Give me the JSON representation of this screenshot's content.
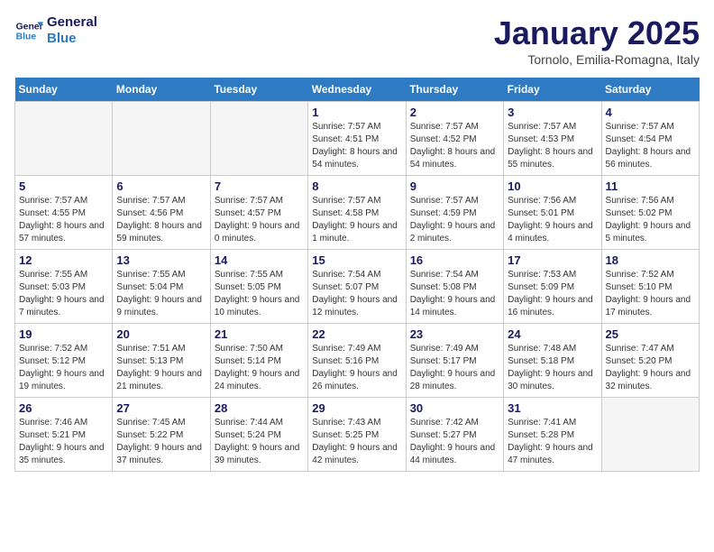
{
  "logo": {
    "line1": "General",
    "line2": "Blue"
  },
  "title": "January 2025",
  "subtitle": "Tornolo, Emilia-Romagna, Italy",
  "days_of_week": [
    "Sunday",
    "Monday",
    "Tuesday",
    "Wednesday",
    "Thursday",
    "Friday",
    "Saturday"
  ],
  "weeks": [
    [
      {
        "day": "",
        "empty": true
      },
      {
        "day": "",
        "empty": true
      },
      {
        "day": "",
        "empty": true
      },
      {
        "day": "1",
        "sunrise": "7:57 AM",
        "sunset": "4:51 PM",
        "daylight": "8 hours and 54 minutes."
      },
      {
        "day": "2",
        "sunrise": "7:57 AM",
        "sunset": "4:52 PM",
        "daylight": "8 hours and 54 minutes."
      },
      {
        "day": "3",
        "sunrise": "7:57 AM",
        "sunset": "4:53 PM",
        "daylight": "8 hours and 55 minutes."
      },
      {
        "day": "4",
        "sunrise": "7:57 AM",
        "sunset": "4:54 PM",
        "daylight": "8 hours and 56 minutes."
      }
    ],
    [
      {
        "day": "5",
        "sunrise": "7:57 AM",
        "sunset": "4:55 PM",
        "daylight": "8 hours and 57 minutes."
      },
      {
        "day": "6",
        "sunrise": "7:57 AM",
        "sunset": "4:56 PM",
        "daylight": "8 hours and 59 minutes."
      },
      {
        "day": "7",
        "sunrise": "7:57 AM",
        "sunset": "4:57 PM",
        "daylight": "9 hours and 0 minutes."
      },
      {
        "day": "8",
        "sunrise": "7:57 AM",
        "sunset": "4:58 PM",
        "daylight": "9 hours and 1 minute."
      },
      {
        "day": "9",
        "sunrise": "7:57 AM",
        "sunset": "4:59 PM",
        "daylight": "9 hours and 2 minutes."
      },
      {
        "day": "10",
        "sunrise": "7:56 AM",
        "sunset": "5:01 PM",
        "daylight": "9 hours and 4 minutes."
      },
      {
        "day": "11",
        "sunrise": "7:56 AM",
        "sunset": "5:02 PM",
        "daylight": "9 hours and 5 minutes."
      }
    ],
    [
      {
        "day": "12",
        "sunrise": "7:55 AM",
        "sunset": "5:03 PM",
        "daylight": "9 hours and 7 minutes."
      },
      {
        "day": "13",
        "sunrise": "7:55 AM",
        "sunset": "5:04 PM",
        "daylight": "9 hours and 9 minutes."
      },
      {
        "day": "14",
        "sunrise": "7:55 AM",
        "sunset": "5:05 PM",
        "daylight": "9 hours and 10 minutes."
      },
      {
        "day": "15",
        "sunrise": "7:54 AM",
        "sunset": "5:07 PM",
        "daylight": "9 hours and 12 minutes."
      },
      {
        "day": "16",
        "sunrise": "7:54 AM",
        "sunset": "5:08 PM",
        "daylight": "9 hours and 14 minutes."
      },
      {
        "day": "17",
        "sunrise": "7:53 AM",
        "sunset": "5:09 PM",
        "daylight": "9 hours and 16 minutes."
      },
      {
        "day": "18",
        "sunrise": "7:52 AM",
        "sunset": "5:10 PM",
        "daylight": "9 hours and 17 minutes."
      }
    ],
    [
      {
        "day": "19",
        "sunrise": "7:52 AM",
        "sunset": "5:12 PM",
        "daylight": "9 hours and 19 minutes."
      },
      {
        "day": "20",
        "sunrise": "7:51 AM",
        "sunset": "5:13 PM",
        "daylight": "9 hours and 21 minutes."
      },
      {
        "day": "21",
        "sunrise": "7:50 AM",
        "sunset": "5:14 PM",
        "daylight": "9 hours and 24 minutes."
      },
      {
        "day": "22",
        "sunrise": "7:49 AM",
        "sunset": "5:16 PM",
        "daylight": "9 hours and 26 minutes."
      },
      {
        "day": "23",
        "sunrise": "7:49 AM",
        "sunset": "5:17 PM",
        "daylight": "9 hours and 28 minutes."
      },
      {
        "day": "24",
        "sunrise": "7:48 AM",
        "sunset": "5:18 PM",
        "daylight": "9 hours and 30 minutes."
      },
      {
        "day": "25",
        "sunrise": "7:47 AM",
        "sunset": "5:20 PM",
        "daylight": "9 hours and 32 minutes."
      }
    ],
    [
      {
        "day": "26",
        "sunrise": "7:46 AM",
        "sunset": "5:21 PM",
        "daylight": "9 hours and 35 minutes."
      },
      {
        "day": "27",
        "sunrise": "7:45 AM",
        "sunset": "5:22 PM",
        "daylight": "9 hours and 37 minutes."
      },
      {
        "day": "28",
        "sunrise": "7:44 AM",
        "sunset": "5:24 PM",
        "daylight": "9 hours and 39 minutes."
      },
      {
        "day": "29",
        "sunrise": "7:43 AM",
        "sunset": "5:25 PM",
        "daylight": "9 hours and 42 minutes."
      },
      {
        "day": "30",
        "sunrise": "7:42 AM",
        "sunset": "5:27 PM",
        "daylight": "9 hours and 44 minutes."
      },
      {
        "day": "31",
        "sunrise": "7:41 AM",
        "sunset": "5:28 PM",
        "daylight": "9 hours and 47 minutes."
      },
      {
        "day": "",
        "empty": true
      }
    ]
  ]
}
